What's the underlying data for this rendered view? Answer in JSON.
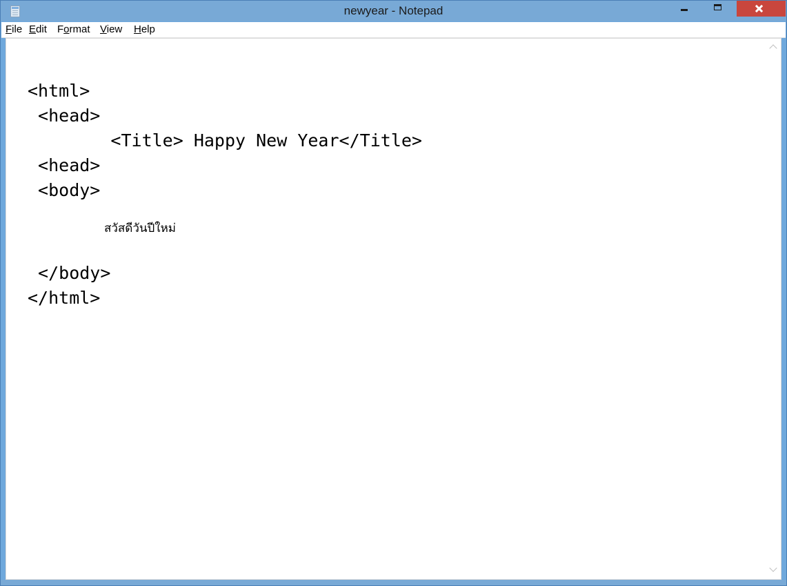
{
  "window": {
    "title": "newyear - Notepad",
    "accent_color": "#78a9d6",
    "close_color": "#c9463d"
  },
  "icons": {
    "app": "notepad-icon",
    "minimize": "minimize-icon",
    "maximize": "maximize-icon",
    "close": "close-icon",
    "scroll_up": "chevron-up-icon",
    "scroll_down": "chevron-down-icon"
  },
  "menu": {
    "file": {
      "u": "F",
      "rest": "ile"
    },
    "edit": {
      "u": "E",
      "rest": "dit"
    },
    "format": {
      "pre": "F",
      "u": "o",
      "rest": "rmat"
    },
    "view": {
      "u": "V",
      "rest": "iew"
    },
    "help": {
      "u": "H",
      "rest": "elp"
    }
  },
  "editor": {
    "lines": [
      "<html>",
      " <head>",
      "        <Title> Happy New Year</Title>",
      " <head>",
      " <body>",
      "สวัสดีวันปีใหม่",
      "",
      " </body>",
      "</html>"
    ]
  }
}
